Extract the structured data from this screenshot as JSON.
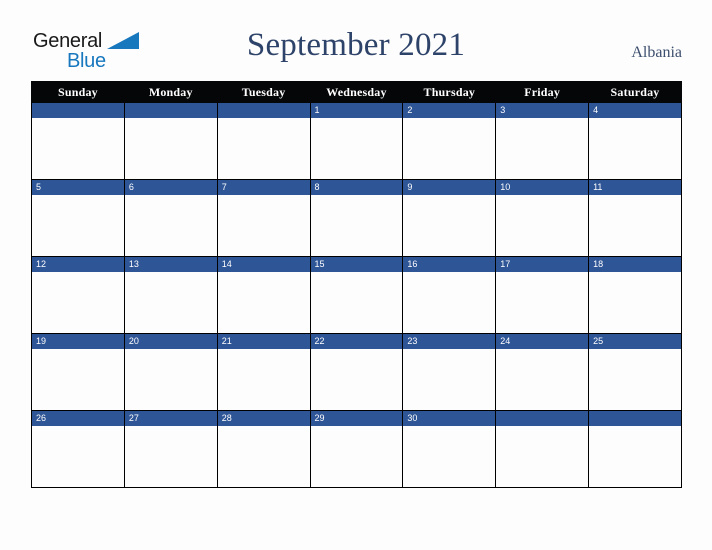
{
  "logo": {
    "word_primary": "General",
    "word_secondary": "Blue",
    "triangle_icon": "triangle-icon",
    "primary_color": "#1a1a1a",
    "secondary_color": "#1878be"
  },
  "header": {
    "title": "September 2021",
    "month": "September",
    "year": "2021",
    "country": "Albania",
    "title_color": "#2e4369",
    "country_color": "#3d4f6e"
  },
  "calendar": {
    "weekday_headers": [
      "Sunday",
      "Monday",
      "Tuesday",
      "Wednesday",
      "Thursday",
      "Friday",
      "Saturday"
    ],
    "header_bg": "#050608",
    "header_text_color": "#ffffff",
    "date_band_color": "#2e5596",
    "date_text_color": "#ffffff",
    "cell_bg": "#fdfdfd",
    "border_color": "#000000",
    "weeks": [
      [
        "",
        "",
        "",
        "1",
        "2",
        "3",
        "4"
      ],
      [
        "5",
        "6",
        "7",
        "8",
        "9",
        "10",
        "11"
      ],
      [
        "12",
        "13",
        "14",
        "15",
        "16",
        "17",
        "18"
      ],
      [
        "19",
        "20",
        "21",
        "22",
        "23",
        "24",
        "25"
      ],
      [
        "26",
        "27",
        "28",
        "29",
        "30",
        "",
        ""
      ]
    ]
  },
  "page": {
    "background": "#fdfdfd"
  }
}
